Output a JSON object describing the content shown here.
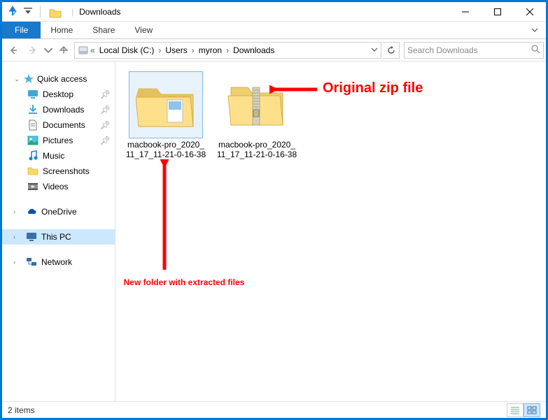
{
  "window": {
    "title": "Downloads"
  },
  "ribbon": {
    "file_tab": "File",
    "tabs": [
      "Home",
      "Share",
      "View"
    ]
  },
  "address": {
    "root_icon": "disk",
    "crumbs": [
      "Local Disk (C:)",
      "Users",
      "myron",
      "Downloads"
    ],
    "overflow_marker": "«"
  },
  "search": {
    "placeholder": "Search Downloads"
  },
  "nav": {
    "quick_access": {
      "label": "Quick access",
      "items": [
        {
          "icon": "desktop",
          "label": "Desktop",
          "pinned": true
        },
        {
          "icon": "downloads",
          "label": "Downloads",
          "pinned": true
        },
        {
          "icon": "documents",
          "label": "Documents",
          "pinned": true
        },
        {
          "icon": "pictures",
          "label": "Pictures",
          "pinned": true
        },
        {
          "icon": "music",
          "label": "Music",
          "pinned": false
        },
        {
          "icon": "folder",
          "label": "Screenshots",
          "pinned": false
        },
        {
          "icon": "videos",
          "label": "Videos",
          "pinned": false
        }
      ]
    },
    "onedrive": {
      "label": "OneDrive"
    },
    "thispc": {
      "label": "This PC",
      "selected": true
    },
    "network": {
      "label": "Network"
    }
  },
  "files": [
    {
      "type": "folder",
      "name": "macbook-pro_2020_11_17_11-21-0-16-38",
      "selected": true
    },
    {
      "type": "zip",
      "name": "macbook-pro_2020_11_17_11-21-0-16-38",
      "selected": false
    }
  ],
  "status": {
    "text": "2 items"
  },
  "annotations": {
    "zip_label": "Original zip file",
    "folder_label": "New folder with extracted files"
  }
}
